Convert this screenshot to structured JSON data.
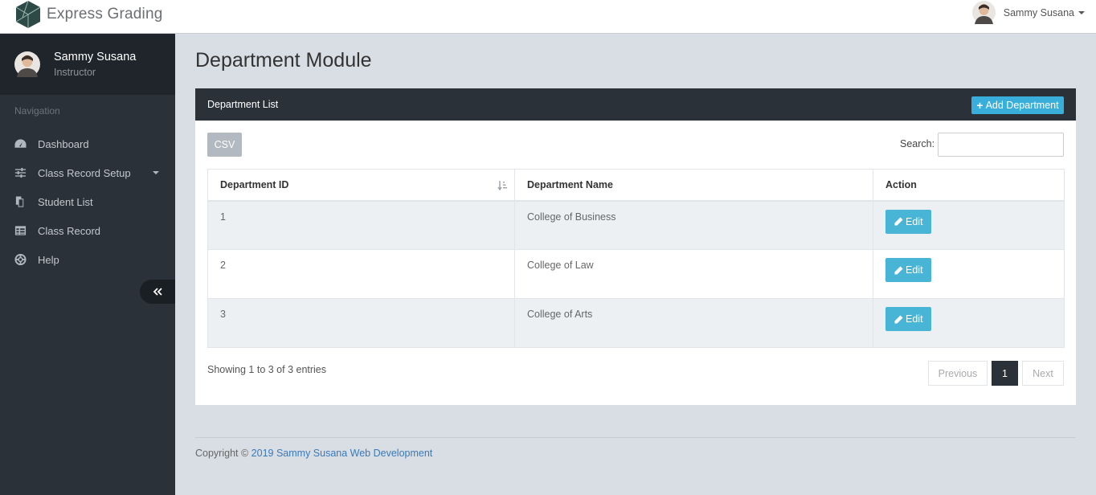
{
  "app": {
    "brand": "Express Grading"
  },
  "header": {
    "user_name": "Sammy Susana"
  },
  "sidebar": {
    "profile": {
      "name": "Sammy Susana",
      "role": "Instructor"
    },
    "heading": "Navigation",
    "items": [
      {
        "label": "Dashboard",
        "icon": "dashboard-icon"
      },
      {
        "label": "Class Record Setup",
        "icon": "sliders-icon",
        "has_submenu": true
      },
      {
        "label": "Student List",
        "icon": "copy-icon"
      },
      {
        "label": "Class Record",
        "icon": "table-icon"
      },
      {
        "label": "Help",
        "icon": "life-ring-icon"
      }
    ]
  },
  "main": {
    "page_title": "Department Module",
    "panel": {
      "title": "Department List",
      "add_button": "Add Department",
      "csv_button": "CSV",
      "search_label": "Search:",
      "search_value": ""
    },
    "table": {
      "columns": [
        "Department ID",
        "Department Name",
        "Action"
      ],
      "rows": [
        {
          "id": "1",
          "name": "College of Business",
          "action": "Edit"
        },
        {
          "id": "2",
          "name": "College of Law",
          "action": "Edit"
        },
        {
          "id": "3",
          "name": "College of Arts",
          "action": "Edit"
        }
      ]
    },
    "info": "Showing 1 to 3 of 3 entries",
    "pagination": {
      "previous": "Previous",
      "current": "1",
      "next": "Next"
    }
  },
  "footer": {
    "prefix": "Copyright ©",
    "link": "2019 Sammy Susana Web Development"
  },
  "colors": {
    "sidebar": "#2a3139",
    "accent": "#3aaedb",
    "background": "#d9dee4"
  }
}
